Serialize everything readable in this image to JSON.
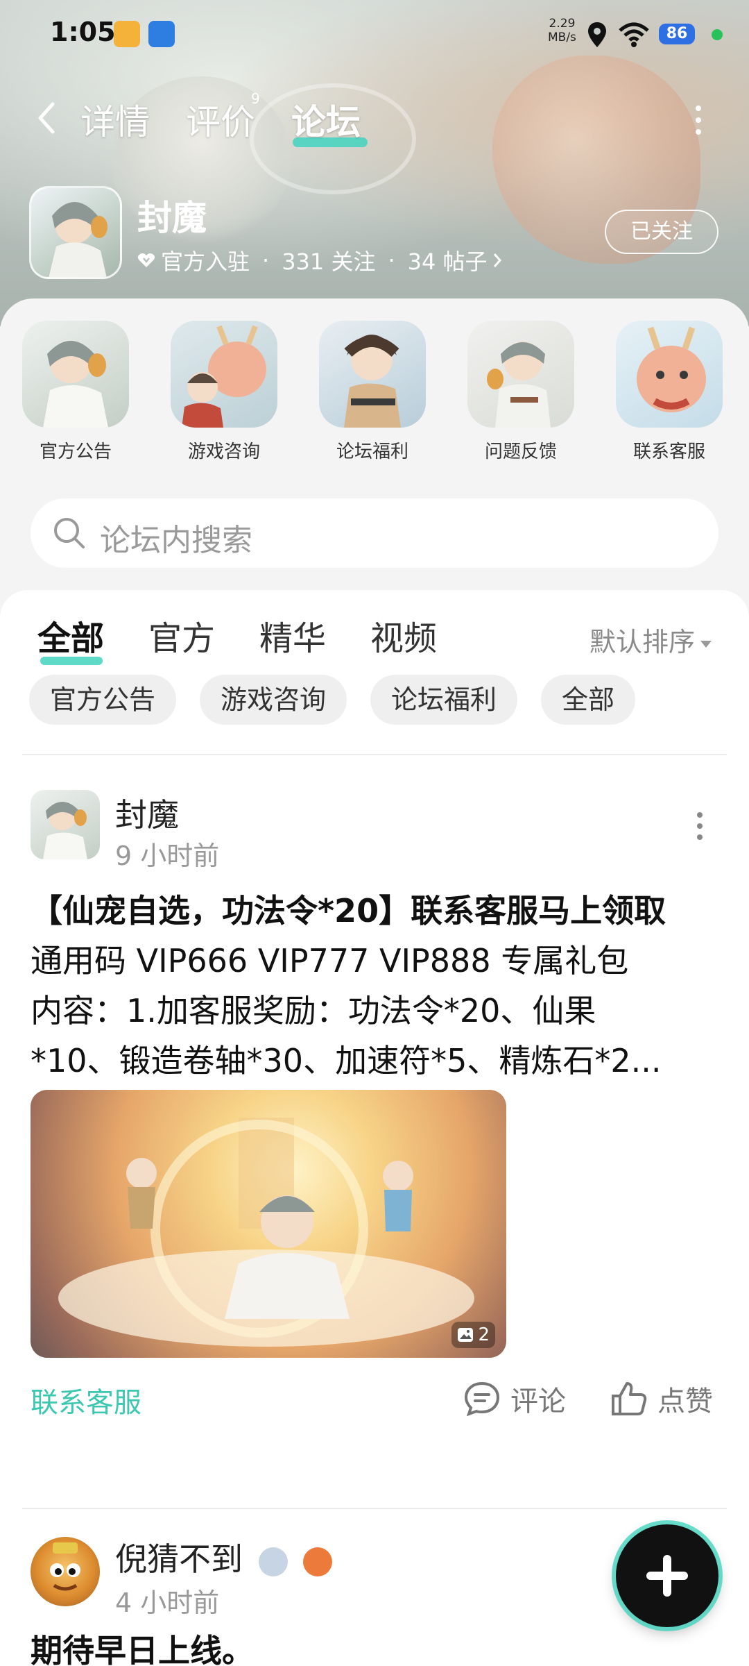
{
  "status_bar": {
    "time": "1:05",
    "speed_value": "2.29",
    "speed_unit": "MB/s",
    "battery": "86"
  },
  "nav": {
    "tabs": [
      {
        "label": "详情"
      },
      {
        "label": "评价"
      },
      {
        "label": "论坛"
      }
    ],
    "review_count": "9",
    "active_tab": "论坛"
  },
  "game": {
    "name": "封魔",
    "official": "官方入驻",
    "followers": "331 关注",
    "posts": "34 帖子",
    "follow_label": "已关注"
  },
  "boards": [
    {
      "label": "官方公告"
    },
    {
      "label": "游戏咨询"
    },
    {
      "label": "论坛福利"
    },
    {
      "label": "问题反馈"
    },
    {
      "label": "联系客服"
    }
  ],
  "search": {
    "placeholder": "论坛内搜索"
  },
  "feed_tabs": [
    {
      "label": "全部"
    },
    {
      "label": "官方"
    },
    {
      "label": "精华"
    },
    {
      "label": "视频"
    }
  ],
  "sort_label": "默认排序",
  "chips": [
    {
      "label": "官方公告"
    },
    {
      "label": "游戏咨询"
    },
    {
      "label": "论坛福利"
    },
    {
      "label": "全部"
    }
  ],
  "posts": [
    {
      "author": "封魔",
      "time": "9 小时前",
      "title": "【仙宠自选，功法令*20】联系客服马上领取",
      "line2": "通用码 VIP666 VIP777 VIP888 专属礼包",
      "line3": "内容：1.加客服奖励：功法令*20、仙果",
      "line4": "*10、锻造卷轴*30、加速符*5、精炼石*2...",
      "image_count": "2",
      "tag": "联系客服",
      "comment_label": "评论",
      "like_label": "点赞"
    },
    {
      "author": "倪猜不到",
      "time": "4 小时前",
      "body": "期待早日上线。"
    }
  ],
  "colors": {
    "accent": "#43d4bf",
    "tag": "#3cc7b0",
    "battery": "#2f6fe4"
  }
}
